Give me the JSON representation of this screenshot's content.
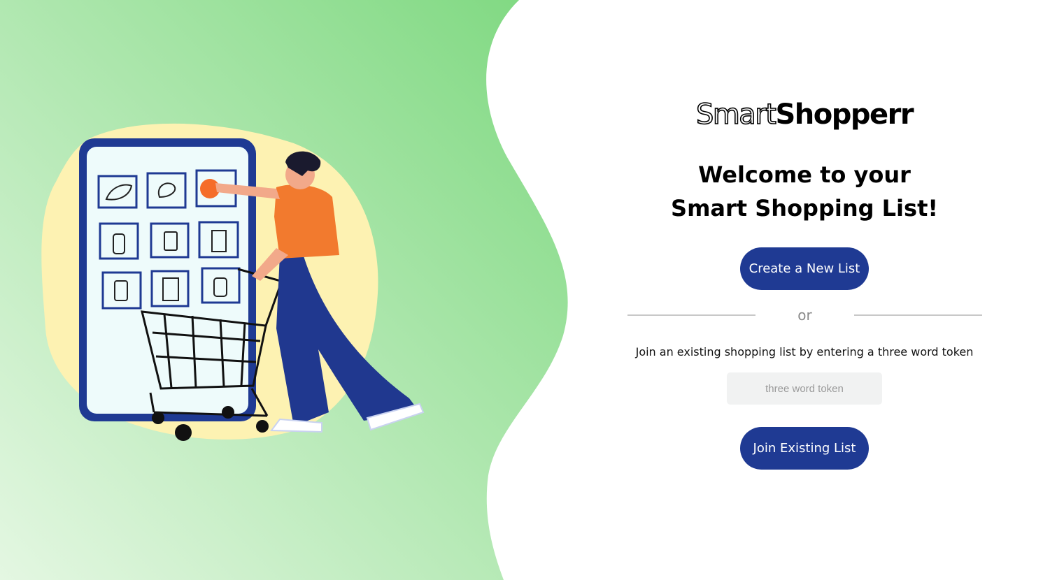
{
  "app": {
    "logo_outline": "Smart",
    "logo_solid": "Shopperr"
  },
  "welcome": {
    "line1": "Welcome to your",
    "line2": "Smart Shopping List!"
  },
  "actions": {
    "create_label": "Create a New List",
    "divider_text": "or",
    "join_instructions": "Join an existing shopping list by entering a three word token",
    "token_placeholder": "three word token",
    "token_value": "",
    "join_label": "Join Existing List"
  },
  "colors": {
    "accent": "#1f3a93",
    "green_top": "#7dd87f",
    "green_bottom": "#e4f7e2",
    "input_bg": "#f1f2f2"
  },
  "illustration": {
    "subject": "shopper-with-cart-icon"
  }
}
